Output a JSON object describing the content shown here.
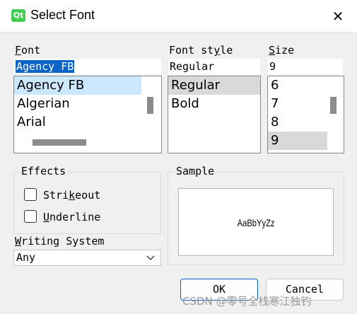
{
  "window": {
    "title": "Select Font",
    "app_icon_text": "Qt",
    "close_glyph": "✕"
  },
  "font": {
    "label": "Font",
    "value": "Agency FB",
    "items": [
      "Agency FB",
      "Algerian",
      "Arial"
    ],
    "selected": "Agency FB"
  },
  "font_style": {
    "label": "Font style",
    "value": "Regular",
    "items": [
      "Regular",
      "Bold"
    ],
    "selected": "Regular"
  },
  "size": {
    "label": "Size",
    "value": "9",
    "items": [
      "6",
      "7",
      "8",
      "9"
    ],
    "selected": "9"
  },
  "effects": {
    "label": "Effects",
    "strikeout": {
      "label": "Strikeout",
      "checked": false
    },
    "underline": {
      "label": "Underline",
      "checked": false
    }
  },
  "sample": {
    "label": "Sample",
    "text": "AaBbYyZz"
  },
  "writing_system": {
    "label": "Writing System",
    "value": "Any"
  },
  "buttons": {
    "ok": "OK",
    "cancel": "Cancel"
  },
  "watermark": "CSDN @零号全栈寒江独钓",
  "colors": {
    "selection_blue": "#0a64c8",
    "list_selected_blue": "#cce8ff",
    "list_selected_gray": "#d9d9d9"
  }
}
